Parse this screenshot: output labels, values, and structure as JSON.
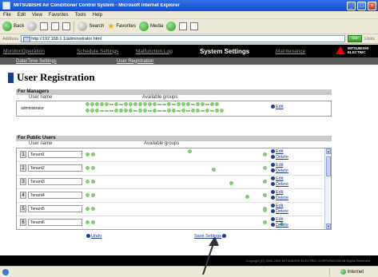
{
  "window": {
    "title": "MITSUBISHI Air Conditioner Control System - Microsoft Internet Explorer",
    "controls": [
      "_",
      "□",
      "×"
    ]
  },
  "menu": [
    "File",
    "Edit",
    "View",
    "Favorites",
    "Tools",
    "Help"
  ],
  "toolbar": {
    "back": "Back",
    "search": "Search",
    "favorites": "Favorites",
    "media": "Media"
  },
  "address": {
    "label": "Address",
    "url": "http://192.168.1.1/administrator.html",
    "go": "Go",
    "links": "Links"
  },
  "nav": {
    "items": [
      "Monitor/Operation",
      "Schedule Settings",
      "Malfunction Log",
      "System Settings",
      "Maintenance"
    ],
    "active_index": 3,
    "logo_text": "MITSUBISHI ELECTRIC"
  },
  "subnav": [
    "Date/Time Settings",
    "User Registration"
  ],
  "page_title": "User Registration",
  "managers": {
    "section": "For Managers",
    "col_user": "User name",
    "col_groups": "Available groups",
    "user": "administrator",
    "edit": "Edit"
  },
  "public": {
    "section": "For Public Users",
    "col_user": "User name",
    "col_groups": "Available groups",
    "edit": "Edit",
    "delete": "Delete",
    "rows": [
      {
        "num": "1",
        "name": "Tenant1"
      },
      {
        "num": "2",
        "name": "Tenant2"
      },
      {
        "num": "3",
        "name": "Tenant3"
      },
      {
        "num": "4",
        "name": "Tenant4"
      },
      {
        "num": "5",
        "name": "Tenant5"
      },
      {
        "num": "6",
        "name": "Tenant6"
      }
    ]
  },
  "actions": {
    "undo": "Undo",
    "save": "Save Settings"
  },
  "footer": "Copyright (C) 2002-2005 MITSUBISHI ELECTRIC CORPORATION All Rights Reserved",
  "status": {
    "zone": "Internet"
  },
  "colors": {
    "accent": "#1a3aa0",
    "group_dot": "#7fcf6e",
    "nav_bg": "#000000"
  }
}
